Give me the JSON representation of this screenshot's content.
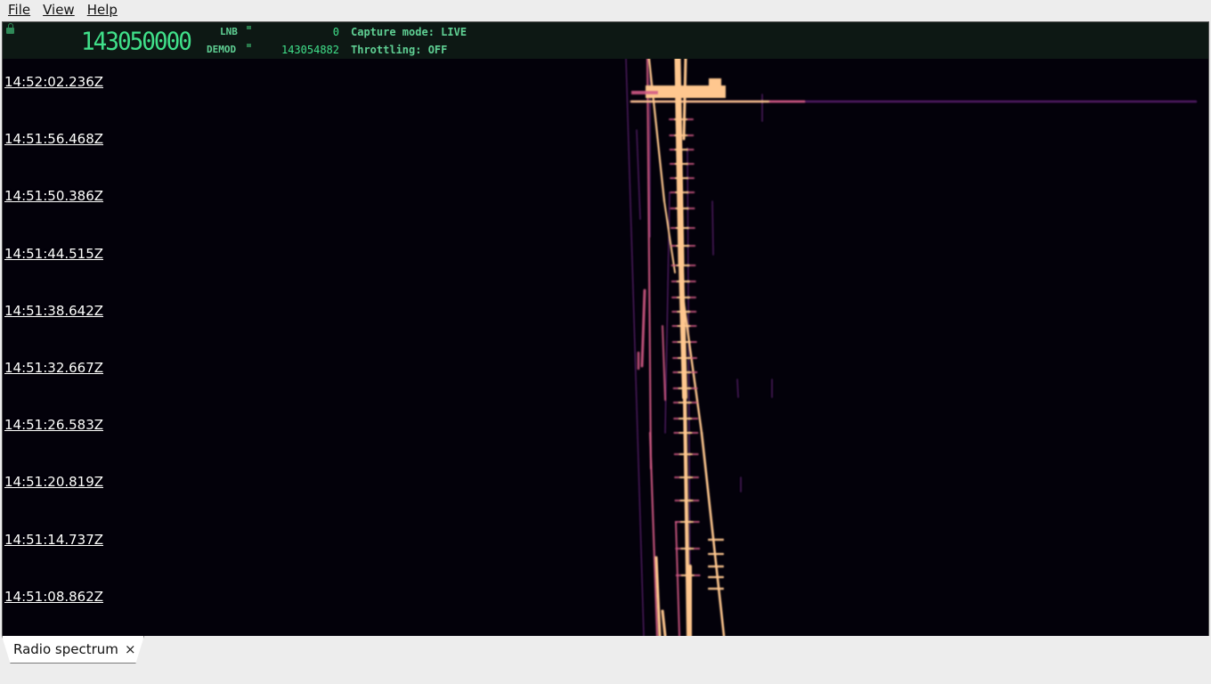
{
  "menu": {
    "file_label": "File",
    "view_label": "View",
    "help_label": "Help"
  },
  "header": {
    "tuned_frequency": "143050000",
    "lnb_label": "LNB",
    "lnb_value": "0",
    "demod_label": "DEMOD",
    "demod_value": "143054882",
    "capture_mode": "Capture mode: LIVE",
    "throttling": "Throttling: OFF"
  },
  "waterfall": {
    "timestamps": [
      "14:52:02.236Z",
      "14:51:56.468Z",
      "14:51:50.386Z",
      "14:51:44.515Z",
      "14:51:38.642Z",
      "14:51:32.667Z",
      "14:51:26.583Z",
      "14:51:20.819Z",
      "14:51:14.737Z",
      "14:51:08.862Z"
    ],
    "colors": {
      "background": "#03010a",
      "hot": "#ffc78f",
      "mid": "#d35a86",
      "low": "#5a1f6e"
    }
  },
  "tabs": [
    {
      "label": "Radio spectrum",
      "close_icon": "×"
    }
  ]
}
